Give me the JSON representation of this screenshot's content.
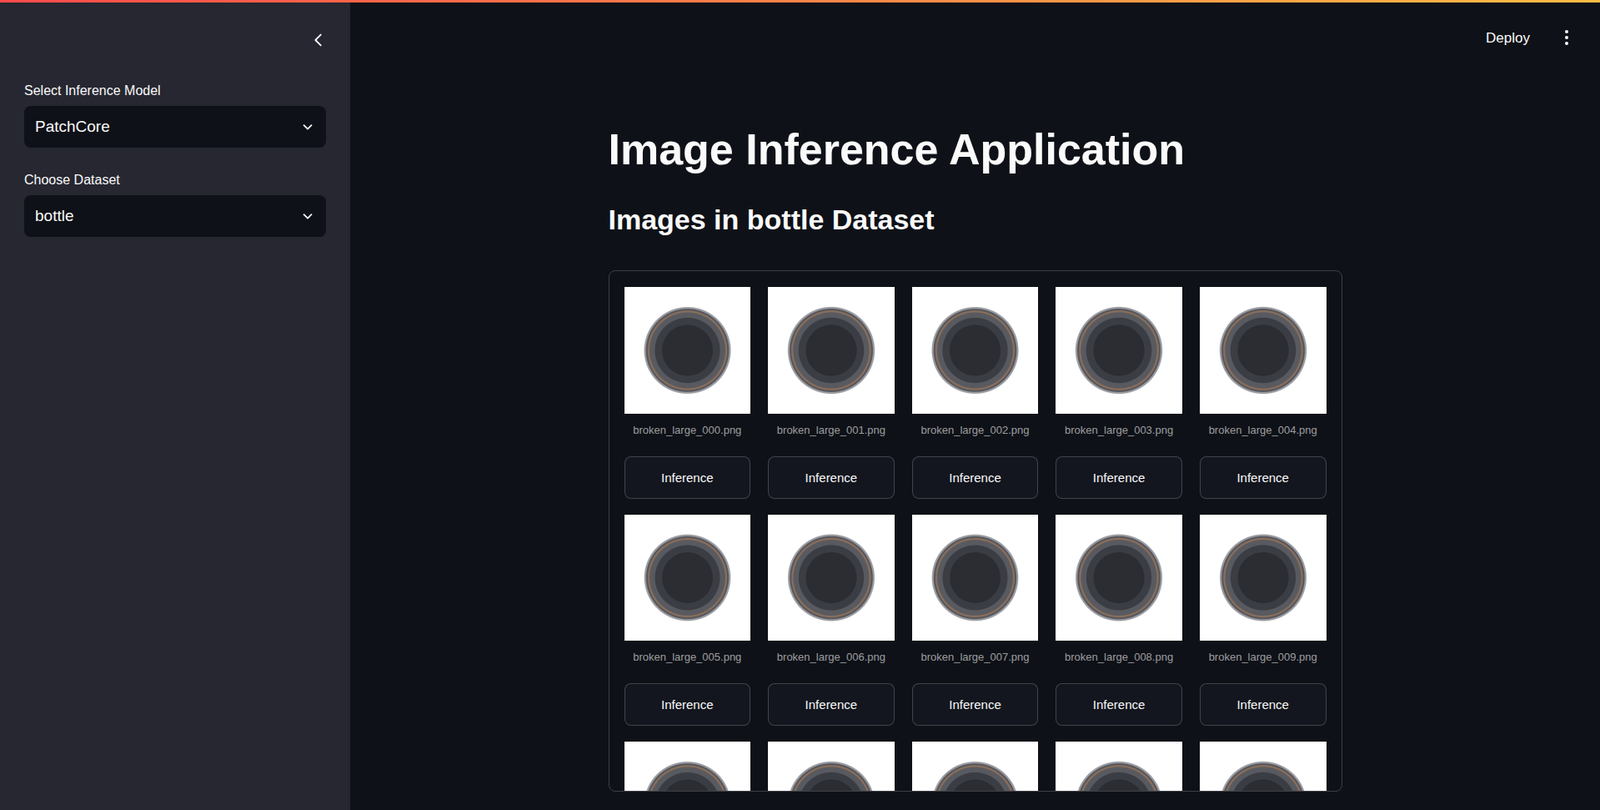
{
  "sidebar": {
    "fields": [
      {
        "label": "Select Inference Model",
        "value": "PatchCore"
      },
      {
        "label": "Choose Dataset",
        "value": "bottle"
      }
    ]
  },
  "header": {
    "deploy": "Deploy"
  },
  "main": {
    "title": "Image Inference Application",
    "subtitle": "Images in bottle Dataset"
  },
  "gallery": {
    "rows": [
      {
        "items": [
          {
            "kind": "card",
            "caption": "broken_large_000.png",
            "button": "Inference"
          },
          {
            "kind": "card",
            "caption": "broken_large_001.png",
            "button": "Inference"
          },
          {
            "kind": "card",
            "caption": "broken_large_002.png",
            "button": "Inference"
          },
          {
            "kind": "card",
            "caption": "broken_large_003.png",
            "button": "Inference"
          },
          {
            "kind": "card",
            "caption": "broken_large_004.png",
            "button": "Inference"
          }
        ]
      },
      {
        "items": [
          {
            "kind": "card",
            "caption": "broken_large_005.png",
            "button": "Inference"
          },
          {
            "kind": "card",
            "caption": "broken_large_006.png",
            "button": "Inference"
          },
          {
            "kind": "card",
            "caption": "broken_large_007.png",
            "button": "Inference"
          },
          {
            "kind": "card",
            "caption": "broken_large_008.png",
            "button": "Inference"
          },
          {
            "kind": "card",
            "caption": "broken_large_009.png",
            "button": "Inference"
          }
        ]
      },
      {
        "items": [
          {
            "kind": "image-only"
          },
          {
            "kind": "image-only"
          },
          {
            "kind": "image-only"
          },
          {
            "kind": "image-only"
          },
          {
            "kind": "image-only"
          }
        ]
      }
    ]
  }
}
